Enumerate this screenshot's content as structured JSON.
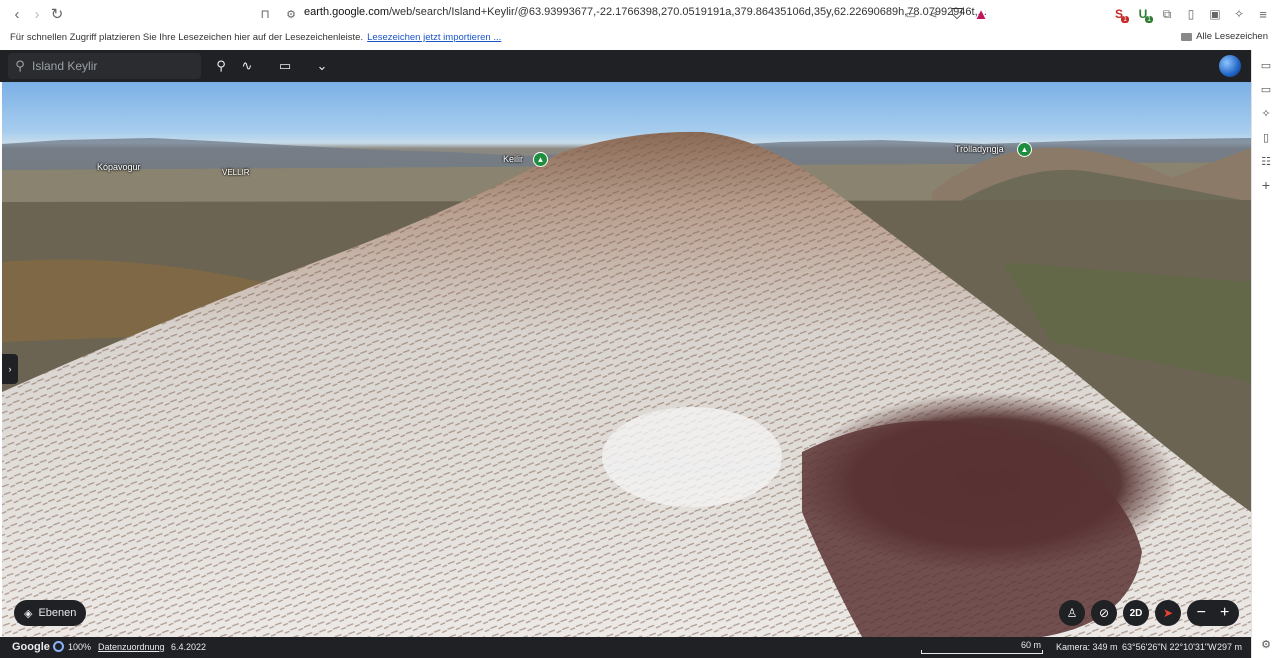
{
  "browser": {
    "url_host": "earth.google.com",
    "url_rest": "/web/search/Island+Keylir/@63.93993677,-22.1766398,270.0519191a,379.86435106d,35y,62.22690689h,78.07992946t,...",
    "bookmarks_hint": "Für schnellen Zugriff platzieren Sie Ihre Lesezeichen hier auf der Lesezeichenleiste.",
    "bookmarks_import_link": "Lesezeichen jetzt importieren ...",
    "all_bookmarks": "Alle Lesezeichen",
    "extension_badge_1": "1",
    "extension_badge_2": "1"
  },
  "earth": {
    "search_value": "Island Keylir",
    "layers_label": "Ebenen",
    "view_mode_label": "2D",
    "places": {
      "kopavogur": "Kópavogur",
      "vellir": "VELLIR",
      "keilir": "Keilir",
      "trolladyngja": "Trölladyngja"
    }
  },
  "status": {
    "brand": "Google",
    "loading": "100%",
    "attribution": "Datenzuordnung",
    "date": "6.4.2022",
    "scale": "60 m",
    "camera": "Kamera: 349 m",
    "coords": "63°56'26\"N 22°10'31\"W",
    "elevation": "297 m"
  },
  "colors": {
    "earth_chrome": "#202124",
    "pin_green": "#1e8e3e",
    "link_blue": "#1a55c4"
  }
}
